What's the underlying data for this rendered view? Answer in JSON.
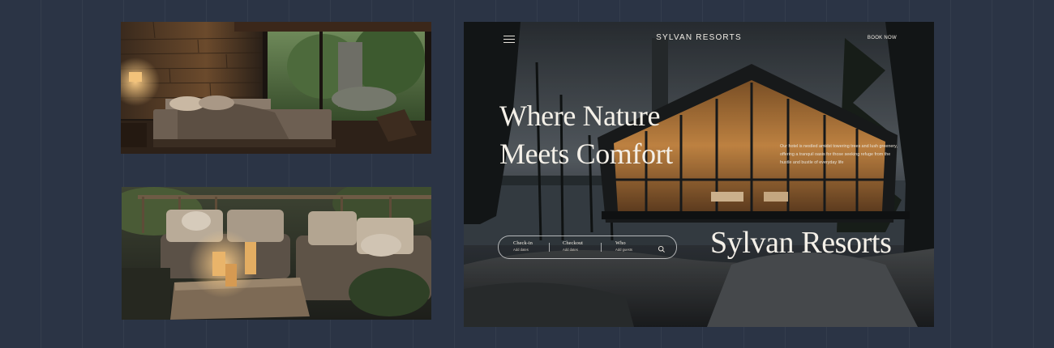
{
  "gallery": {
    "images": [
      {
        "subject": "bedroom-image"
      },
      {
        "subject": "patio-image"
      }
    ]
  },
  "hero": {
    "nav": {
      "menu_icon": "hamburger-menu-icon",
      "brand": "SYLVAN RESORTS",
      "cta": "BOOK NOW"
    },
    "headline_line1": "Where Nature",
    "headline_line2": "Meets Comfort",
    "description": "Our hotel is nestled amidst towering trees and lush greenery, offering a tranquil oasis for those seeking refuge from the hustle and bustle of everyday life",
    "brand_large": "Sylvan Resorts",
    "booking": {
      "checkin_label": "Check-in",
      "checkin_placeholder": "Add dates",
      "checkout_label": "Checkout",
      "checkout_placeholder": "Add dates",
      "who_label": "Who",
      "who_placeholder": "Add guests",
      "search_icon": "search-icon"
    }
  },
  "colors": {
    "page_background": "#2b3445",
    "text_light": "#f4f0e8",
    "warm_light": "#e9a55a"
  }
}
